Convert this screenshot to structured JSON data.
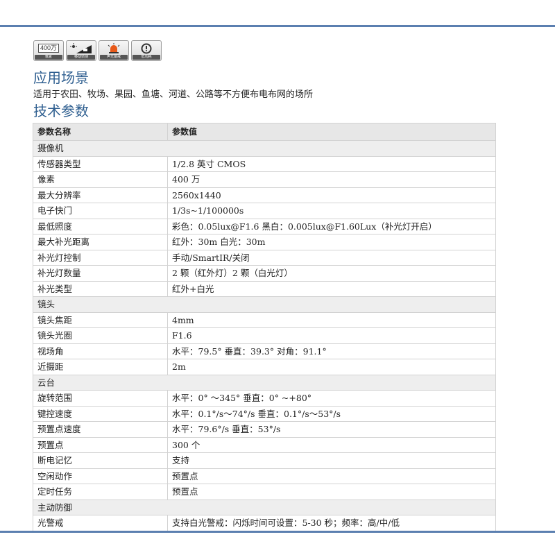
{
  "feature_icons": [
    {
      "name": "4mp",
      "top": "400万",
      "label": "像素"
    },
    {
      "name": "motion",
      "label": "移动侦测"
    },
    {
      "name": "alarm",
      "label": "声光警戒"
    },
    {
      "name": "low-power",
      "label": "低功耗"
    }
  ],
  "section_application": {
    "title": "应用场景",
    "text": "适用于农田、牧场、果园、鱼塘、河道、公路等不方便布电布网的场所"
  },
  "section_specs": {
    "title": "技术参数",
    "headers": [
      "参数名称",
      "参数值"
    ],
    "groups": [
      {
        "name": "摄像机",
        "rows": [
          [
            "传感器类型",
            "1/2.8 英寸 CMOS"
          ],
          [
            "像素",
            "400 万"
          ],
          [
            "最大分辨率",
            "2560x1440"
          ],
          [
            "电子快门",
            "1/3s~1/100000s"
          ],
          [
            "最低照度",
            "彩色：0.05lux@F1.6 黑白：0.005lux@F1.60Lux（补光灯开启）"
          ],
          [
            "最大补光距离",
            "红外：30m 白光：30m"
          ],
          [
            "补光灯控制",
            "手动/SmartIR/关闭"
          ],
          [
            "补光灯数量",
            "2 颗（红外灯）2 颗（白光灯）"
          ],
          [
            "补光类型",
            "红外+白光"
          ]
        ]
      },
      {
        "name": "镜头",
        "rows": [
          [
            "镜头焦距",
            "4mm"
          ],
          [
            "镜头光圈",
            "F1.6"
          ],
          [
            "视场角",
            "水平：79.5° 垂直：39.3° 对角：91.1°"
          ],
          [
            "近摄距",
            "2m"
          ]
        ]
      },
      {
        "name": "云台",
        "rows": [
          [
            "旋转范围",
            "水平：0° ～345° 垂直：0° ~+80°"
          ],
          [
            "键控速度",
            "水平：0.1°/s～74°/s 垂直：0.1°/s～53°/s"
          ],
          [
            "预置点速度",
            "水平：79.6°/s 垂直：53°/s"
          ],
          [
            "预置点",
            "300 个"
          ],
          [
            "断电记忆",
            "支持"
          ],
          [
            "空闲动作",
            "预置点"
          ],
          [
            "定时任务",
            "预置点"
          ]
        ]
      },
      {
        "name": "主动防御",
        "rows": [
          [
            "光警戒",
            "支持白光警戒：闪烁时间可设置：5-30 秒；频率：高/中/低"
          ]
        ]
      }
    ]
  },
  "colors": {
    "accent": "#2f5f90",
    "rule": "#5b7fb0",
    "header_bg": "#e7e7e7",
    "group_bg": "#eeeeee",
    "border": "#d2d2d2"
  }
}
